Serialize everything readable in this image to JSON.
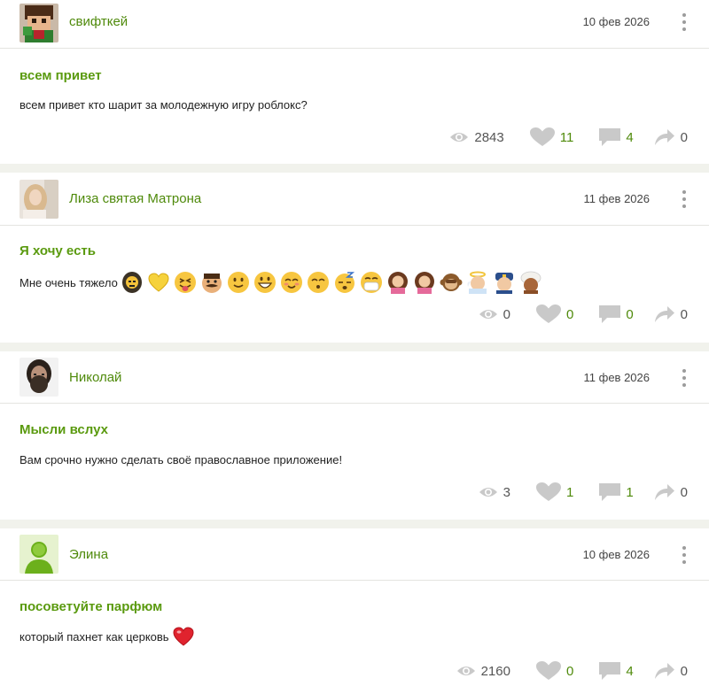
{
  "posts": [
    {
      "username": "свифткей",
      "date": "10 фев 2026",
      "title": "всем привет",
      "text": "всем привет кто шарит за молодежную игру роблокс?",
      "views": "2843",
      "likes": "11",
      "comments": "4",
      "shares": "0",
      "avatar_icon": "pixel-character-avatar",
      "emojis": []
    },
    {
      "username": "Лиза святая Матрона",
      "date": "11 фев 2026",
      "title": "Я хочу есть",
      "text": "Мне очень тяжело",
      "views": "0",
      "likes": "0",
      "comments": "0",
      "shares": "0",
      "avatar_icon": "photo-avatar",
      "emojis": [
        "person-emoji",
        "yellow-heart-emoji",
        "tongue-face-emoji",
        "mustache-face-emoji",
        "smile-emoji",
        "grin-emoji",
        "blush-emoji",
        "kiss-emoji",
        "sleepy-emoji",
        "mask-emoji",
        "girl-emoji",
        "girl-emoji",
        "monkey-emoji",
        "angel-emoji",
        "police-emoji",
        "turban-emoji"
      ]
    },
    {
      "username": "Николай",
      "date": "11 фев 2026",
      "title": "Мысли вслух",
      "text": "Вам срочно нужно сделать своё православное приложение!",
      "views": "3",
      "likes": "1",
      "comments": "1",
      "shares": "0",
      "avatar_icon": "bearded-man-avatar",
      "emojis": []
    },
    {
      "username": "Элина",
      "date": "10 фев 2026",
      "title": "посоветуйте парфюм",
      "text": "который пахнет как церковь",
      "views": "2160",
      "likes": "0",
      "comments": "4",
      "shares": "0",
      "avatar_icon": "default-user-avatar",
      "emojis": [
        "red-heart-emoji"
      ]
    }
  ],
  "colors": {
    "accent": "#4f8a0b",
    "title": "#5a9a0f",
    "icon_grey": "#c9c9c9",
    "separator": "#f1f2ec"
  }
}
